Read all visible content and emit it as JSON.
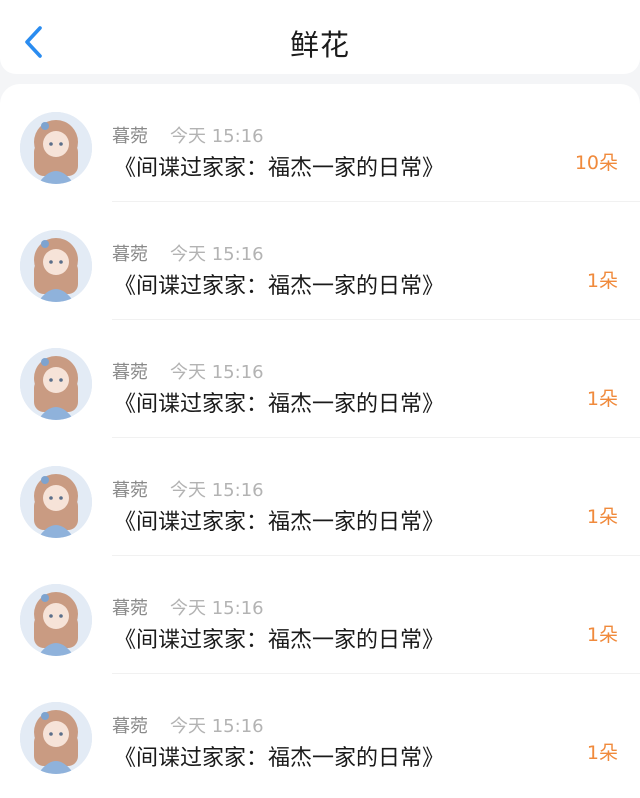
{
  "header": {
    "title": "鲜花",
    "back_icon": "chevron-left-icon",
    "accent_color": "#2a8cf0"
  },
  "records": [
    {
      "user": "暮菀",
      "time": "今天 15:16",
      "book": "《间谍过家家：福杰一家的日常》",
      "flowers": "10朵"
    },
    {
      "user": "暮菀",
      "time": "今天 15:16",
      "book": "《间谍过家家：福杰一家的日常》",
      "flowers": "1朵"
    },
    {
      "user": "暮菀",
      "time": "今天 15:16",
      "book": "《间谍过家家：福杰一家的日常》",
      "flowers": "1朵"
    },
    {
      "user": "暮菀",
      "time": "今天 15:16",
      "book": "《间谍过家家：福杰一家的日常》",
      "flowers": "1朵"
    },
    {
      "user": "暮菀",
      "time": "今天 15:16",
      "book": "《间谍过家家：福杰一家的日常》",
      "flowers": "1朵"
    },
    {
      "user": "暮菀",
      "time": "今天 15:16",
      "book": "《间谍过家家：福杰一家的日常》",
      "flowers": "1朵"
    }
  ],
  "colors": {
    "flower_count": "#f08a3c",
    "username": "#8a8a8a",
    "timestamp": "#b3b3b3"
  }
}
